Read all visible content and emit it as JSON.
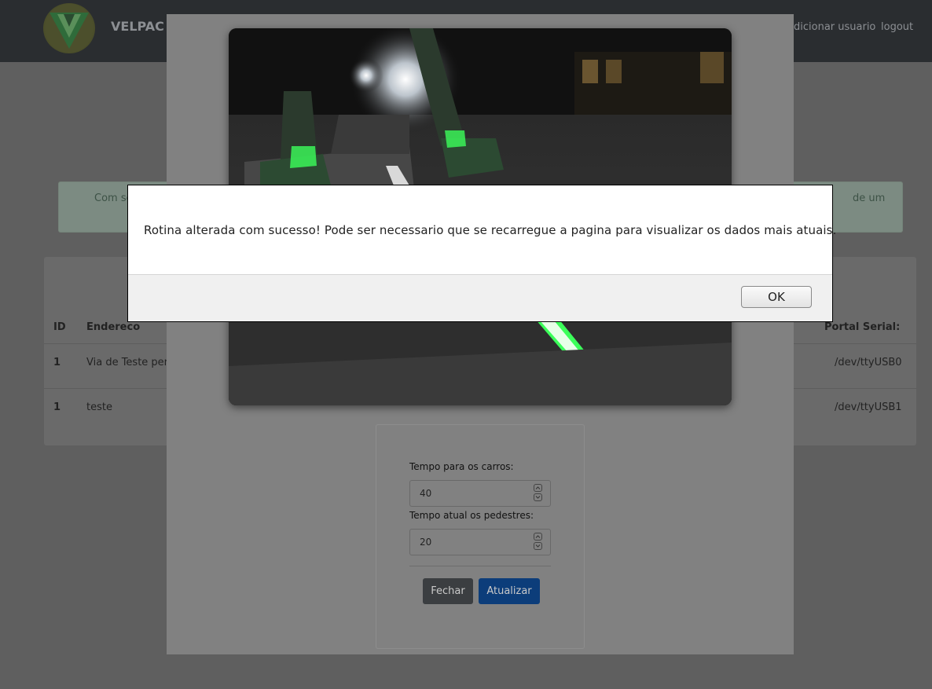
{
  "navbar": {
    "brand": "VELPAC -",
    "links": [
      "dicionar usuario",
      "logout"
    ]
  },
  "alert": {
    "left_text": "Com se",
    "right_text": "de um"
  },
  "table": {
    "headers": [
      "ID",
      "Endereco",
      "Portal Serial:"
    ],
    "rows": [
      {
        "id": "1",
        "address": "Via de Teste perto",
        "port": "/dev/ttyUSB0"
      },
      {
        "id": "1",
        "address": "teste",
        "port": "/dev/ttyUSB1"
      }
    ]
  },
  "modal": {
    "car_time_label": "Tempo para os carros:",
    "car_time_value": "40",
    "ped_time_label": "Tempo atual os pedestres:",
    "ped_time_value": "20",
    "close_label": "Fechar",
    "update_label": "Atualizar"
  },
  "dialog": {
    "message": "Rotina alterada com sucesso! Pode ser necessario que se recarregue a pagina para visualizar os dados mais atuais.",
    "ok_label": "OK"
  },
  "colors": {
    "overlay_page": "#5f5f5f",
    "navbar": "#2a2d30",
    "primary_button": "#0c3d7a",
    "secondary_button": "#3b3e41",
    "crosswalk_light": "#3cff5a"
  },
  "icons": [
    "logo-v-icon",
    "spin-up-icon",
    "spin-down-icon"
  ]
}
